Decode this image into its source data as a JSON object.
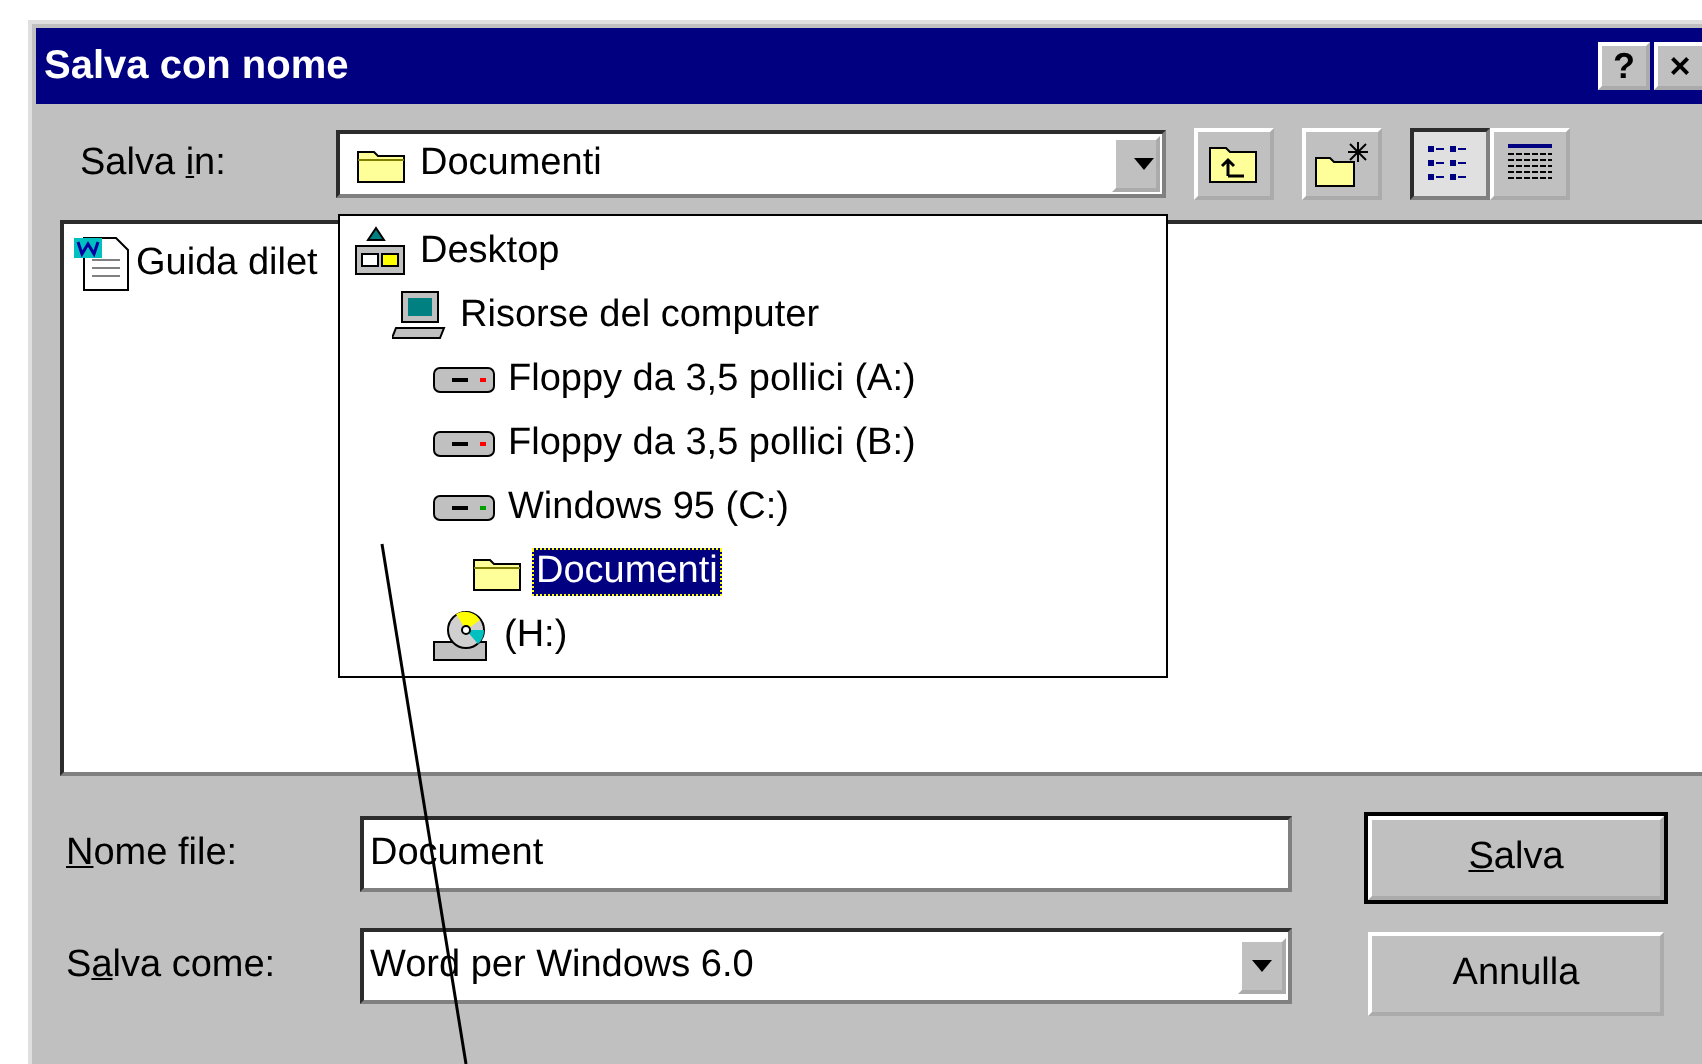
{
  "window": {
    "title": "Salva con nome",
    "title_buttons": [
      "?",
      "×"
    ]
  },
  "save_in": {
    "label": {
      "pre": "Salva ",
      "key": "i",
      "post": "n:"
    },
    "value": "Documenti",
    "kind": "folder",
    "expanded": true,
    "tree": [
      {
        "name": "Desktop",
        "kind": "desktop",
        "selected": false,
        "children": [
          {
            "name": "Risorse del computer",
            "kind": "computer",
            "selected": false,
            "children": [
              {
                "name": "Floppy da 3,5 pollici (A:)",
                "kind": "floppy",
                "selected": false
              },
              {
                "name": "Floppy da 3,5 pollici (B:)",
                "kind": "floppy",
                "selected": false
              },
              {
                "name": "Windows 95 (C:)",
                "kind": "drive",
                "selected": false,
                "children": [
                  {
                    "name": "Documenti",
                    "kind": "folder",
                    "selected": true
                  }
                ]
              },
              {
                "name": "(H:)",
                "kind": "cdrom",
                "selected": false
              }
            ]
          }
        ]
      }
    ]
  },
  "toolbar": [
    {
      "kind": "up-folder",
      "selected": false
    },
    {
      "kind": "new-folder",
      "selected": false
    },
    {
      "kind": "list",
      "selected": true
    },
    {
      "kind": "details",
      "selected": false
    }
  ],
  "files": [
    {
      "name": "Guida dilet",
      "kind": "word-doc"
    }
  ],
  "file_name": {
    "label": {
      "key": "N",
      "post": "ome file:"
    },
    "value": "Document"
  },
  "save_as": {
    "label": {
      "pre": "S",
      "key": "a",
      "post": "lva come:"
    },
    "value": "Word per Windows 6.0"
  },
  "buttons": [
    {
      "label": {
        "key": "S",
        "post": "alva"
      },
      "default": true
    },
    {
      "label": {
        "pre": "Annulla"
      },
      "default": false
    }
  ]
}
